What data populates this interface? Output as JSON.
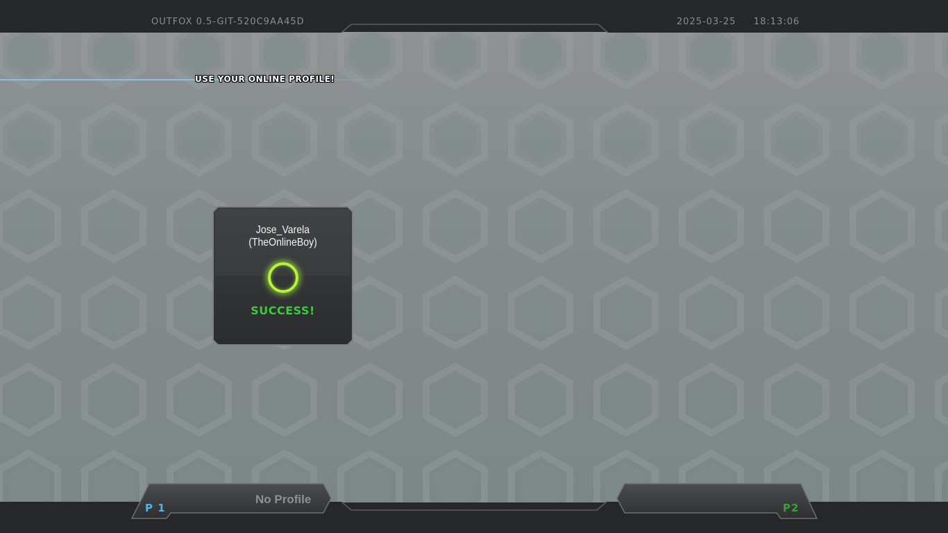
{
  "header": {
    "version": "OUTFOX 0.5-GIT-520C9AA45D",
    "date": "2025-03-25",
    "time": "18:13:06",
    "title": "USE YOUR ONLINE PROFILE!"
  },
  "profile_card": {
    "name": "Jose_Varela (TheOnlineBoy)",
    "status": "SUCCESS!"
  },
  "players": {
    "p1": {
      "label": "P 1",
      "profile": "No Profile"
    },
    "p2": {
      "label": "P2"
    }
  },
  "colors": {
    "accent_blue": "#7ec6e4",
    "p1": "#4fb6e6",
    "p2": "#3aa23a",
    "success": "#3fc93c",
    "ring": "#b8f23a"
  }
}
